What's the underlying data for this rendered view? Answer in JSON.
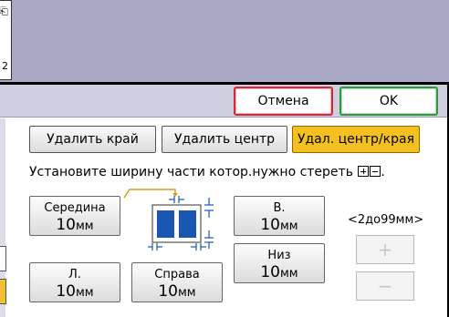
{
  "top_panel": {
    "thumbnail_page_number": "2",
    "thumbnail_icon": "document-icon"
  },
  "actions": {
    "cancel_label": "Отмена",
    "ok_label": "OK",
    "cancel_color": "#d3283a",
    "ok_color": "#2a9a3a"
  },
  "tabs": [
    {
      "label": "Удалить край",
      "selected": false
    },
    {
      "label": "Удалить центр",
      "selected": false
    },
    {
      "label": "Удал. центр/края",
      "selected": true
    }
  ],
  "selected_color": "#f4c020",
  "instruction": {
    "text": "Установите ширину части котор.нужно стереть",
    "suffix": "."
  },
  "fields": {
    "middle": {
      "label": "Середина",
      "value": "10",
      "unit": "мм"
    },
    "top": {
      "label": "В.",
      "value": "10",
      "unit": "мм"
    },
    "bottom": {
      "label": "Низ",
      "value": "10",
      "unit": "мм"
    },
    "left": {
      "label": "Л.",
      "value": "10",
      "unit": "мм"
    },
    "right": {
      "label": "Справа",
      "value": "10",
      "unit": "мм"
    }
  },
  "range_text": "<2до99мм>",
  "stepper": {
    "plus": "+",
    "minus": "−"
  }
}
